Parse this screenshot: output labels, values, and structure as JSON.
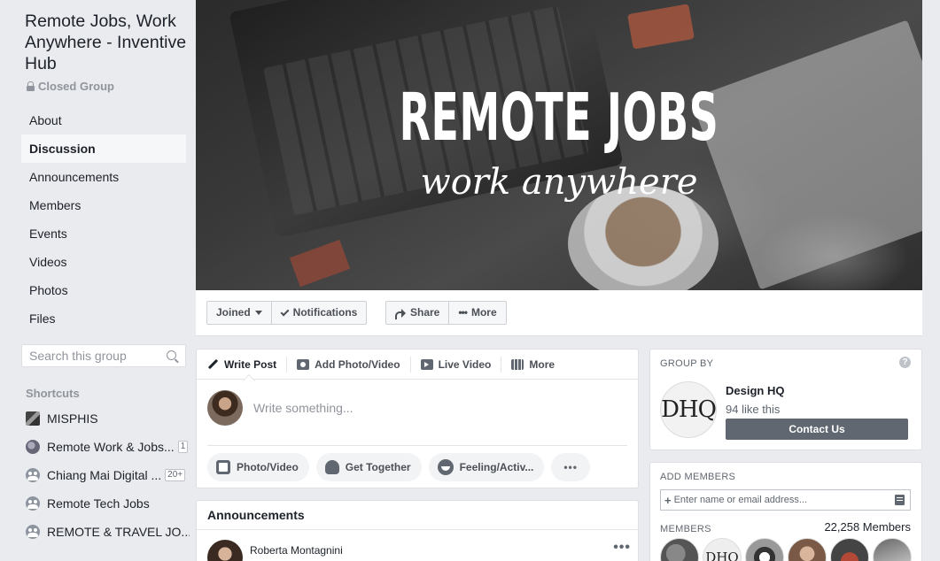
{
  "group": {
    "title": "Remote Jobs, Work Anywhere - Inventive Hub",
    "privacy": "Closed Group"
  },
  "sidebar": {
    "nav": [
      {
        "label": "About",
        "active": false
      },
      {
        "label": "Discussion",
        "active": true
      },
      {
        "label": "Announcements",
        "active": false
      },
      {
        "label": "Members",
        "active": false
      },
      {
        "label": "Events",
        "active": false
      },
      {
        "label": "Videos",
        "active": false
      },
      {
        "label": "Photos",
        "active": false
      },
      {
        "label": "Files",
        "active": false
      }
    ],
    "search_placeholder": "Search this group",
    "shortcuts_heading": "Shortcuts",
    "shortcuts": [
      {
        "label": "MISPHIS",
        "badge": "",
        "icon": "group-photo-icon"
      },
      {
        "label": "Remote Work & Jobs...",
        "badge": "1",
        "icon": "globe-icon"
      },
      {
        "label": "Chiang Mai Digital ...",
        "badge": "20+",
        "icon": "group-people-icon"
      },
      {
        "label": "Remote Tech Jobs",
        "badge": "",
        "icon": "group-people-icon"
      },
      {
        "label": "REMOTE & TRAVEL JO...",
        "badge": "",
        "icon": "group-people-icon"
      }
    ]
  },
  "cover": {
    "title": "REMOTE JOBS",
    "subtitle": "work anywhere"
  },
  "actions": {
    "joined": "Joined",
    "notifications": "Notifications",
    "share": "Share",
    "more": "More"
  },
  "composer": {
    "tabs": {
      "write_post": "Write Post",
      "add_photo": "Add Photo/Video",
      "live_video": "Live Video",
      "more": "More"
    },
    "placeholder": "Write something...",
    "buttons": {
      "photo_video": "Photo/Video",
      "get_together": "Get Together",
      "feeling": "Feeling/Activ...",
      "more": "•••"
    }
  },
  "announcements": {
    "title": "Announcements",
    "author": "Roberta Montagnini",
    "menu": "•••"
  },
  "group_by": {
    "heading": "GROUP BY",
    "help": "?",
    "page_logo": "DHQ",
    "page_name": "Design HQ",
    "likes": "94 like this",
    "contact_button": "Contact Us"
  },
  "add_members": {
    "heading": "ADD MEMBERS",
    "placeholder": "Enter name or email address...",
    "members_heading": "MEMBERS",
    "members_count": "22,258 Members",
    "member_logo_text": "DHQ"
  },
  "colors": {
    "page_bg": "#e9ebee",
    "card_bg": "#ffffff",
    "text": "#1d2129",
    "muted": "#90949c",
    "button_dark": "#606770"
  }
}
